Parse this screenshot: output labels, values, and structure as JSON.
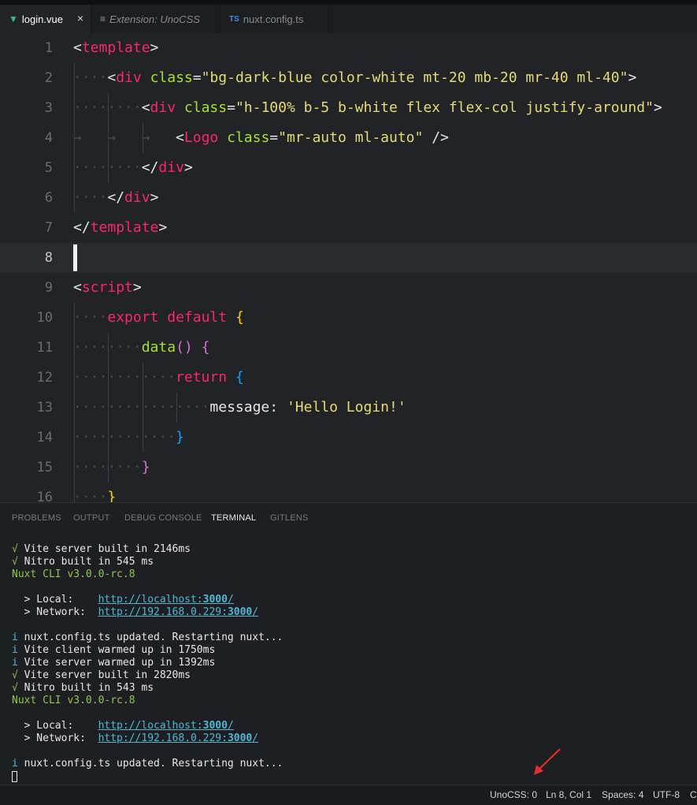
{
  "tabs": [
    {
      "icon": "vue-icon",
      "label": "login.vue",
      "close": "×",
      "active": true
    },
    {
      "icon": "preview-icon",
      "label": "Extension: UnoCSS",
      "active": false
    },
    {
      "icon": "ts-icon",
      "icon_text": "TS",
      "label": "nuxt.config.ts",
      "active": false
    }
  ],
  "editor": {
    "current_line": 8,
    "lines": [
      {
        "n": "1",
        "dots": "",
        "tokens": [
          [
            "<",
            "punc"
          ],
          [
            "template",
            "tag"
          ],
          [
            ">",
            "punc"
          ]
        ]
      },
      {
        "n": "2",
        "dots": "····",
        "tokens": [
          [
            "    ",
            "punc"
          ],
          [
            "<",
            "punc"
          ],
          [
            "div",
            "tag"
          ],
          [
            " ",
            "punc"
          ],
          [
            "class",
            "attr"
          ],
          [
            "=",
            "punc"
          ],
          [
            "\"bg-dark-blue color-white mt-20 mb-20 mr-40 ml-40\"",
            "str"
          ],
          [
            ">",
            "punc"
          ]
        ]
      },
      {
        "n": "3",
        "dots": "········",
        "tokens": [
          [
            "        ",
            "punc"
          ],
          [
            "<",
            "punc"
          ],
          [
            "div",
            "tag"
          ],
          [
            " ",
            "punc"
          ],
          [
            "class",
            "attr"
          ],
          [
            "=",
            "punc"
          ],
          [
            "\"h-100% b-5 b-white flex flex-col justify-around\"",
            "str"
          ],
          [
            ">",
            "punc"
          ]
        ]
      },
      {
        "n": "4",
        "dots": "→   →   →",
        "tokens": [
          [
            "            ",
            "punc"
          ],
          [
            "<",
            "punc"
          ],
          [
            "Logo",
            "tag"
          ],
          [
            " ",
            "punc"
          ],
          [
            "class",
            "attr"
          ],
          [
            "=",
            "punc"
          ],
          [
            "\"mr-auto ml-auto\"",
            "str"
          ],
          [
            " />",
            "punc"
          ]
        ]
      },
      {
        "n": "5",
        "dots": "········",
        "tokens": [
          [
            "        ",
            "punc"
          ],
          [
            "</",
            "punc"
          ],
          [
            "div",
            "tag"
          ],
          [
            ">",
            "punc"
          ]
        ]
      },
      {
        "n": "6",
        "dots": "····",
        "tokens": [
          [
            "    ",
            "punc"
          ],
          [
            "</",
            "punc"
          ],
          [
            "div",
            "tag"
          ],
          [
            ">",
            "punc"
          ]
        ]
      },
      {
        "n": "7",
        "dots": "",
        "tokens": [
          [
            "</",
            "punc"
          ],
          [
            "template",
            "tag"
          ],
          [
            ">",
            "punc"
          ]
        ]
      },
      {
        "n": "8",
        "dots": "",
        "tokens": []
      },
      {
        "n": "9",
        "dots": "",
        "tokens": [
          [
            "<",
            "punc"
          ],
          [
            "script",
            "tag"
          ],
          [
            ">",
            "punc"
          ]
        ]
      },
      {
        "n": "10",
        "dots": "····",
        "tokens": [
          [
            "    ",
            "punc"
          ],
          [
            "export",
            "kw"
          ],
          [
            " ",
            "punc"
          ],
          [
            "default",
            "kw"
          ],
          [
            " ",
            "punc"
          ],
          [
            "{",
            "br1"
          ]
        ]
      },
      {
        "n": "11",
        "dots": "········",
        "tokens": [
          [
            "        ",
            "punc"
          ],
          [
            "data",
            "fn"
          ],
          [
            "()",
            "br2"
          ],
          [
            " ",
            "punc"
          ],
          [
            "{",
            "br2"
          ]
        ]
      },
      {
        "n": "12",
        "dots": "············",
        "tokens": [
          [
            "            ",
            "punc"
          ],
          [
            "return",
            "kw"
          ],
          [
            " ",
            "punc"
          ],
          [
            "{",
            "br3"
          ]
        ]
      },
      {
        "n": "13",
        "dots": "················",
        "tokens": [
          [
            "                ",
            "punc"
          ],
          [
            "message: ",
            "punc"
          ],
          [
            "'Hello Login!'",
            "str"
          ]
        ]
      },
      {
        "n": "14",
        "dots": "············",
        "tokens": [
          [
            "            ",
            "punc"
          ],
          [
            "}",
            "br3"
          ]
        ]
      },
      {
        "n": "15",
        "dots": "········",
        "tokens": [
          [
            "        ",
            "punc"
          ],
          [
            "}",
            "br2"
          ]
        ]
      },
      {
        "n": "16",
        "dots": "····",
        "tokens": [
          [
            "    ",
            "punc"
          ],
          [
            "}",
            "br1"
          ]
        ]
      }
    ]
  },
  "panel": {
    "tabs": [
      {
        "label": "PROBLEMS",
        "active": false
      },
      {
        "label": "OUTPUT",
        "active": false
      },
      {
        "label": "DEBUG CONSOLE",
        "active": false
      },
      {
        "label": "TERMINAL",
        "active": true
      },
      {
        "label": "GITLENS",
        "active": false
      }
    ],
    "terminal": [
      [
        [
          "√ ",
          "green"
        ],
        [
          "Vite server built in 2146ms",
          ""
        ]
      ],
      [
        [
          "√ ",
          "green"
        ],
        [
          "Nitro built in 545 ms",
          ""
        ]
      ],
      [
        [
          "Nuxt CLI v3.0.0-rc.8",
          "green"
        ]
      ],
      [],
      [
        [
          "  > Local:    ",
          ""
        ],
        [
          "http://localhost:",
          "link"
        ],
        [
          "3000",
          "link bold"
        ],
        [
          "/",
          "link"
        ]
      ],
      [
        [
          "  > Network:  ",
          ""
        ],
        [
          "http://192.168.0.229:",
          "link"
        ],
        [
          "3000",
          "link bold"
        ],
        [
          "/",
          "link"
        ]
      ],
      [],
      [
        [
          "i ",
          "cyan"
        ],
        [
          "nuxt.config.ts updated. Restarting nuxt...",
          ""
        ]
      ],
      [
        [
          "i ",
          "cyan"
        ],
        [
          "Vite client warmed up in 1750ms",
          ""
        ]
      ],
      [
        [
          "i ",
          "cyan"
        ],
        [
          "Vite server warmed up in 1392ms",
          ""
        ]
      ],
      [
        [
          "√ ",
          "green"
        ],
        [
          "Vite server built in 2820ms",
          ""
        ]
      ],
      [
        [
          "√ ",
          "green"
        ],
        [
          "Nitro built in 543 ms",
          ""
        ]
      ],
      [
        [
          "Nuxt CLI v3.0.0-rc.8",
          "green"
        ]
      ],
      [],
      [
        [
          "  > Local:    ",
          ""
        ],
        [
          "http://localhost:",
          "link"
        ],
        [
          "3000",
          "link bold"
        ],
        [
          "/",
          "link"
        ]
      ],
      [
        [
          "  > Network:  ",
          ""
        ],
        [
          "http://192.168.0.229:",
          "link"
        ],
        [
          "3000",
          "link bold"
        ],
        [
          "/",
          "link"
        ]
      ],
      [],
      [
        [
          "i ",
          "cyan"
        ],
        [
          "nuxt.config.ts updated. Restarting nuxt...",
          ""
        ]
      ]
    ]
  },
  "status": {
    "unocss": "UnoCSS: 0",
    "position": "Ln 8, Col 1",
    "spaces": "Spaces: 4",
    "encoding": "UTF-8",
    "overflow": "C"
  },
  "colors": {
    "accent_arrow": "#e0302a",
    "vue_green": "#41b883",
    "ts_blue": "#3178c6"
  }
}
